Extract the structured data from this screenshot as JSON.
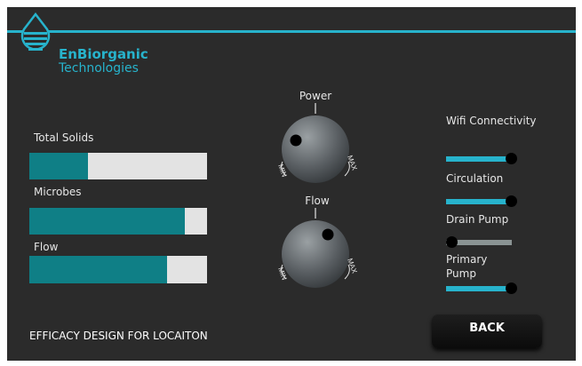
{
  "brand": {
    "name": "EnBiorganic",
    "subtitle": "Technologies",
    "logo_icon": "water-drop-icon"
  },
  "meters": [
    {
      "label": "Total Solids",
      "level": 0.33
    },
    {
      "label": "Microbes",
      "level": 0.875
    },
    {
      "label": "Flow",
      "level": 0.775
    }
  ],
  "knobs": [
    {
      "label": "Power",
      "min_label": "MIN",
      "max_label": "MAX",
      "indicator": "left"
    },
    {
      "label": "Flow",
      "min_label": "MIN",
      "max_label": "MAX",
      "indicator": "upper-right"
    }
  ],
  "toggles": [
    {
      "label": "Wifi Connectivity",
      "state": "on"
    },
    {
      "label": "Circulation",
      "state": "on"
    },
    {
      "label": "Drain Pump",
      "state": "off"
    },
    {
      "label": "Primary Pump",
      "state": "on"
    }
  ],
  "buttons": {
    "back": "BACK"
  },
  "footer": "EFFICACY DESIGN FOR LOCAITON",
  "colors": {
    "accent": "#27b3cc",
    "meter_fill": "#0f7f86",
    "meter_empty": "#e3e3e3",
    "toggle_off": "#8a9393",
    "background": "#2b2b2b"
  }
}
